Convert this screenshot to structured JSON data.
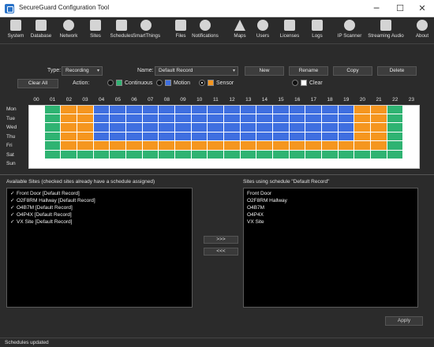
{
  "window": {
    "title": "SecureGuard Configuration Tool",
    "minimize_glyph": "─",
    "maximize_glyph": "☐",
    "close_glyph": "✕"
  },
  "toolbar": [
    {
      "label": "System",
      "icon": "monitor-icon"
    },
    {
      "label": "Database",
      "icon": "database-icon"
    },
    {
      "label": "Network",
      "icon": "network-icon"
    },
    {
      "label": "Sites",
      "icon": "sites-icon"
    },
    {
      "label": "Schedules",
      "icon": "schedules-icon"
    },
    {
      "label": "SmartThings",
      "icon": "smartthings-icon"
    },
    {
      "label": "Files",
      "icon": "folder-icon"
    },
    {
      "label": "Notifications",
      "icon": "bell-icon"
    },
    {
      "label": "Maps",
      "icon": "map-pin-icon"
    },
    {
      "label": "Users",
      "icon": "users-icon"
    },
    {
      "label": "Licenses",
      "icon": "license-icon"
    },
    {
      "label": "Logs",
      "icon": "logs-icon"
    },
    {
      "label": "IP Scanner",
      "icon": "ip-scanner-icon"
    },
    {
      "label": "Streaming Audio",
      "icon": "audio-icon"
    },
    {
      "label": "About",
      "icon": "info-icon"
    }
  ],
  "controls": {
    "type_label": "Type:",
    "type_value": "Recording",
    "name_label": "Name:",
    "name_value": "Default Record",
    "new_label": "New",
    "rename_label": "Rename",
    "copy_label": "Copy",
    "delete_label": "Delete",
    "clear_all_label": "Clear All",
    "action_label": "Action:",
    "actions": [
      {
        "label": "Continuous",
        "color": "#2fb372",
        "selected": false
      },
      {
        "label": "Motion",
        "color": "#3f6fe0",
        "selected": false
      },
      {
        "label": "Sensor",
        "color": "#f5961f",
        "selected": true
      },
      {
        "label": "Clear",
        "color": "#ffffff",
        "selected": false
      }
    ],
    "caret_glyph": "▾"
  },
  "schedule": {
    "hours": [
      "00",
      "01",
      "02",
      "03",
      "04",
      "05",
      "06",
      "07",
      "08",
      "09",
      "10",
      "11",
      "12",
      "13",
      "14",
      "15",
      "16",
      "17",
      "18",
      "19",
      "20",
      "21",
      "22",
      "23"
    ],
    "days": [
      "Mon",
      "Tue",
      "Wed",
      "Thu",
      "Fri",
      "Sat",
      "Sun"
    ],
    "colors": {
      "C": "#2fb372",
      "M": "#3f6fe0",
      "S": "#f5961f",
      "E": "#ffffff"
    },
    "rows": [
      "ECSSMMMMMMMMMMMMMMMMSSCE",
      "ECSSMMMMMMMMMMMMMMMMSSCE",
      "ECSSMMMMMMMMMMMMMMMMSSCE",
      "ECSSMMMMMMMMMMMMMMMMSSCE",
      "ECSSSSSSSSSSSSSSSSSSSSCE",
      "ECCCCCCCCCCCCCCCCCCCCCCE",
      "EEEEEEEEEEEEEEEEEEEEEEEE"
    ]
  },
  "available": {
    "label": "Available Sites (checked sites already have a schedule assigned)",
    "check_glyph": "✓",
    "items": [
      "Front Door [Default Record]",
      "O2F8RM Hallway [Default Record]",
      "O4B7M [Default Record]",
      "O4P4X [Default Record]",
      "VX Site [Default Record]"
    ]
  },
  "assigned": {
    "label": "Sites using schedule \"Default Record\"",
    "items": [
      "Front Door",
      "O2F8RM Hallway",
      "O4B7M",
      "O4P4X",
      "VX Site"
    ]
  },
  "move_right_label": ">>>",
  "move_left_label": "<<<",
  "apply_label": "Apply",
  "status": "Schedules updated"
}
